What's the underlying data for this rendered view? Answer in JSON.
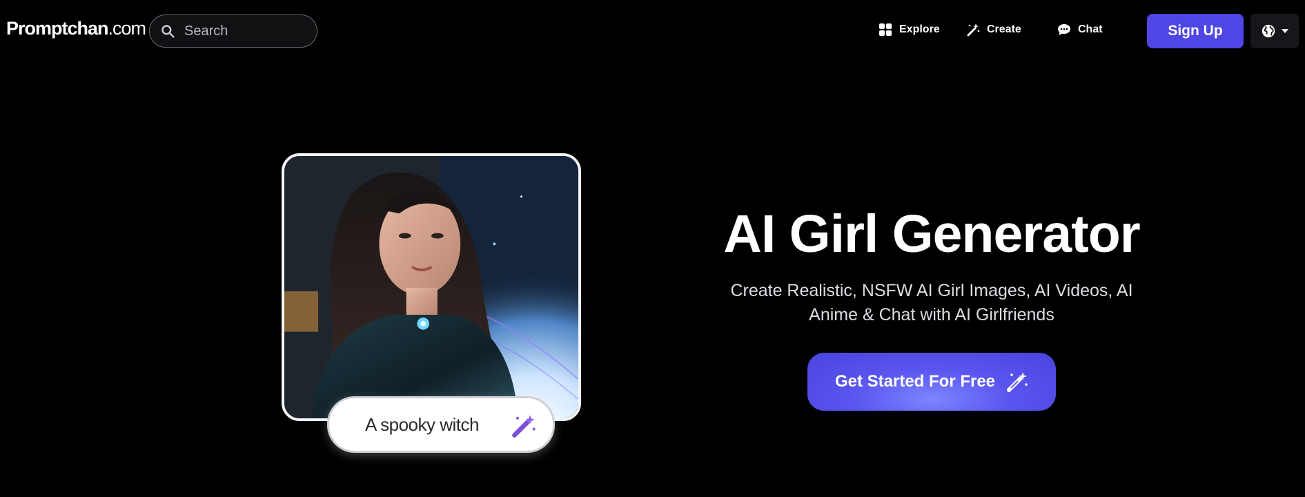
{
  "header": {
    "logo_main": "Promptchan",
    "logo_suffix": ".com",
    "search_placeholder": "Search",
    "nav": [
      {
        "label": "Explore",
        "icon": "grid-icon"
      },
      {
        "label": "Create",
        "icon": "magic-wand-icon"
      },
      {
        "label": "Chat",
        "icon": "chat-bubble-icon"
      }
    ],
    "signup_label": "Sign Up",
    "language_icon": "globe-icon"
  },
  "hero": {
    "title": "AI Girl Generator",
    "subtitle": "Create Realistic, NSFW AI Girl Images, AI Videos, AI Anime & Chat with AI Girlfriends",
    "cta_label": "Get Started For Free",
    "prompt_example": "A spooky witch"
  },
  "colors": {
    "accent": "#4f46e5",
    "background": "#000000"
  }
}
